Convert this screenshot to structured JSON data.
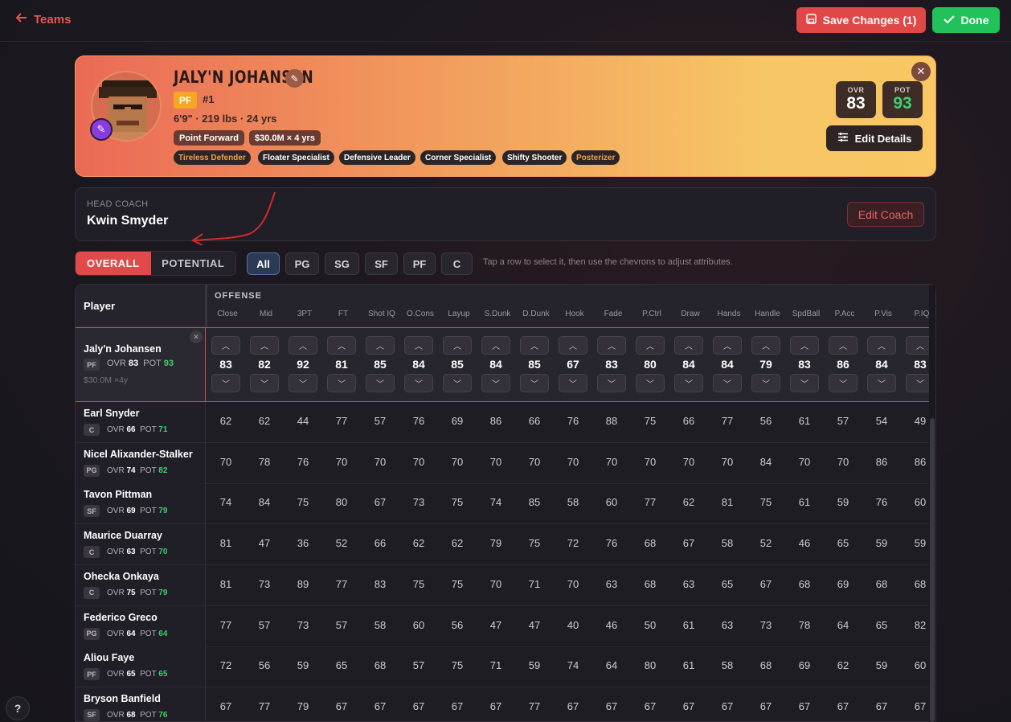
{
  "header": {
    "back_label": "Teams",
    "save_label": "Save Changes (1)",
    "done_label": "Done"
  },
  "player_card": {
    "name": "JALY'N JOHANSEN",
    "position": "PF",
    "number": "#1",
    "meta": "6'9\" · 219 lbs · 24 yrs",
    "archetype": "Point Forward",
    "contract": "$30.0M × 4 yrs",
    "traits": [
      {
        "label": "Tireless Defender",
        "color": "#f0a24a"
      },
      {
        "label": "Floater Specialist",
        "color": "#ffffff"
      },
      {
        "label": "Defensive Leader",
        "color": "#ffffff"
      },
      {
        "label": "Corner Specialist",
        "color": "#ffffff"
      },
      {
        "label": "Shifty Shooter",
        "color": "#ffffff"
      },
      {
        "label": "Posterizer",
        "color": "#f0a24a"
      }
    ],
    "ovr_label": "OVR",
    "ovr": "83",
    "pot_label": "POT",
    "pot": "93",
    "edit_details_label": "Edit Details"
  },
  "coach": {
    "label": "HEAD COACH",
    "name": "Kwin Smyder",
    "edit_label": "Edit Coach"
  },
  "toolbar": {
    "mode_tabs": [
      "OVERALL",
      "POTENTIAL"
    ],
    "active_mode": "OVERALL",
    "position_filters": [
      "All",
      "PG",
      "SG",
      "SF",
      "PF",
      "C"
    ],
    "active_filter": "All",
    "hint": "Tap a row to select it, then use the chevrons to adjust attributes."
  },
  "table": {
    "player_header": "Player",
    "group_label": "OFFENSE",
    "columns": [
      "Close",
      "Mid",
      "3PT",
      "FT",
      "Shot IQ",
      "O.Cons",
      "Layup",
      "S.Dunk",
      "D.Dunk",
      "Hook",
      "Fade",
      "P.Ctrl",
      "Draw",
      "Hands",
      "Handle",
      "SpdBall",
      "P.Acc",
      "P.Vis",
      "P.IQ"
    ],
    "selected": {
      "name": "Jaly'n Johansen",
      "pos": "PF",
      "ovr": "83",
      "pot": "93",
      "contract": "$30.0M ×4y",
      "values": [
        "83",
        "82",
        "92",
        "81",
        "85",
        "84",
        "85",
        "84",
        "85",
        "67",
        "83",
        "80",
        "84",
        "84",
        "79",
        "83",
        "86",
        "84",
        "83"
      ]
    },
    "rows": [
      {
        "name": "Earl Snyder",
        "pos": "C",
        "ovr": "66",
        "pot": "71",
        "values": [
          "62",
          "62",
          "44",
          "77",
          "57",
          "76",
          "69",
          "86",
          "66",
          "76",
          "88",
          "75",
          "66",
          "77",
          "56",
          "61",
          "57",
          "54",
          "49"
        ]
      },
      {
        "name": "Nicel Alixander-Stalker",
        "pos": "PG",
        "ovr": "74",
        "pot": "82",
        "values": [
          "70",
          "78",
          "76",
          "70",
          "70",
          "70",
          "70",
          "70",
          "70",
          "70",
          "70",
          "70",
          "70",
          "70",
          "84",
          "70",
          "70",
          "86",
          "86"
        ]
      },
      {
        "name": "Tavon Pittman",
        "pos": "SF",
        "ovr": "69",
        "pot": "79",
        "values": [
          "74",
          "84",
          "75",
          "80",
          "67",
          "73",
          "75",
          "74",
          "85",
          "58",
          "60",
          "77",
          "62",
          "81",
          "75",
          "61",
          "59",
          "76",
          "60"
        ]
      },
      {
        "name": "Maurice Duarray",
        "pos": "C",
        "ovr": "63",
        "pot": "70",
        "values": [
          "81",
          "47",
          "36",
          "52",
          "66",
          "62",
          "62",
          "79",
          "75",
          "72",
          "76",
          "68",
          "67",
          "58",
          "52",
          "46",
          "65",
          "59",
          "59"
        ]
      },
      {
        "name": "Ohecka Onkaya",
        "pos": "C",
        "ovr": "75",
        "pot": "79",
        "values": [
          "81",
          "73",
          "89",
          "77",
          "83",
          "75",
          "75",
          "70",
          "71",
          "70",
          "63",
          "68",
          "63",
          "65",
          "67",
          "68",
          "69",
          "68",
          "68"
        ]
      },
      {
        "name": "Federico Greco",
        "pos": "PG",
        "ovr": "64",
        "pot": "64",
        "values": [
          "77",
          "57",
          "73",
          "57",
          "58",
          "60",
          "56",
          "47",
          "47",
          "40",
          "46",
          "50",
          "61",
          "63",
          "73",
          "78",
          "64",
          "65",
          "82"
        ]
      },
      {
        "name": "Aliou Faye",
        "pos": "PF",
        "ovr": "65",
        "pot": "65",
        "values": [
          "72",
          "56",
          "59",
          "65",
          "68",
          "57",
          "75",
          "71",
          "59",
          "74",
          "64",
          "80",
          "61",
          "58",
          "68",
          "69",
          "62",
          "59",
          "60"
        ]
      },
      {
        "name": "Bryson Banfield",
        "pos": "SF",
        "ovr": "68",
        "pot": "76",
        "values": [
          "67",
          "77",
          "79",
          "67",
          "67",
          "67",
          "67",
          "67",
          "77",
          "67",
          "67",
          "67",
          "67",
          "67",
          "67",
          "67",
          "67",
          "67",
          "67"
        ]
      }
    ]
  },
  "help_label": "?"
}
